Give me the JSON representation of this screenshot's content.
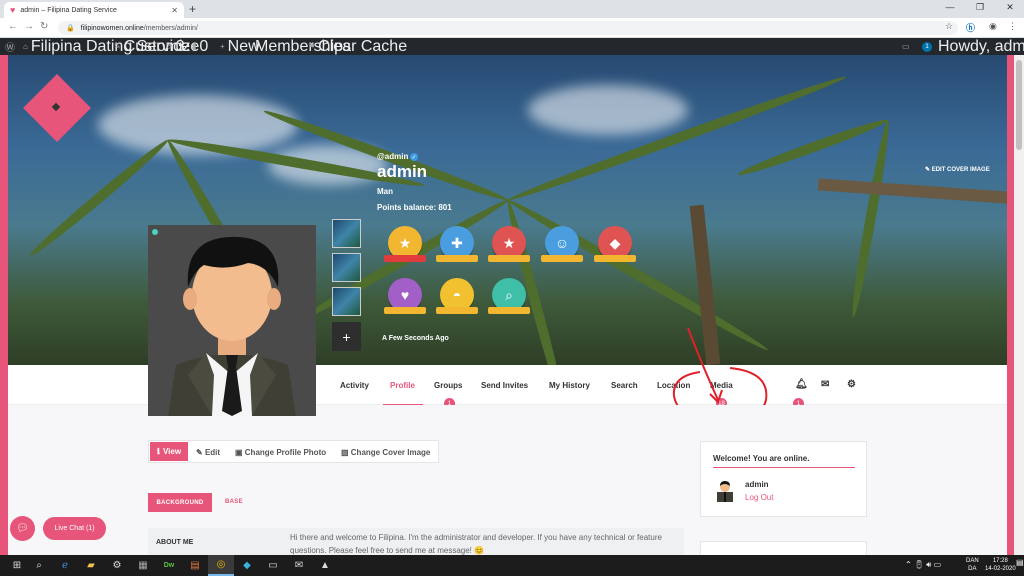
{
  "browser": {
    "tab_title": "admin – Filipina Dating Service",
    "url_host": "filipinowomen.online",
    "url_path": "/members/admin/",
    "new_tab": "+",
    "win_minimize": "—",
    "win_restore": "❐",
    "win_close": "✕"
  },
  "wpbar": {
    "site_name": "Filipina Dating Service",
    "customize": "Customize",
    "updates_count": "3",
    "comments_count": "0",
    "new_label": "New",
    "memberships": "Memberships",
    "clear_cache": "Clear Cache",
    "notif_count": "1",
    "howdy": "Howdy, admin"
  },
  "profile": {
    "edit_cover": "EDIT COVER IMAGE",
    "handle": "@admin",
    "name": "admin",
    "gender": "Man",
    "points": "Points balance: 801",
    "last_seen": "A Few Seconds Ago",
    "add_media": "+"
  },
  "badges": [
    {
      "name": "gold-star-badge",
      "glyph": "★",
      "color": "#f2b630",
      "ribbon": "#e23b3b"
    },
    {
      "name": "blue-plus-badge",
      "glyph": "✚",
      "color": "#4a9ee0",
      "ribbon": "#f2b630"
    },
    {
      "name": "red-star-badge",
      "glyph": "★",
      "color": "#e05353",
      "ribbon": "#f2b630"
    },
    {
      "name": "blue-user-badge",
      "glyph": "☺",
      "color": "#4a9ee0",
      "ribbon": "#f2b630"
    },
    {
      "name": "red-diamond-badge",
      "glyph": "◆",
      "color": "#e05353",
      "ribbon": "#f2b630"
    },
    {
      "name": "purple-heart-badge",
      "glyph": "♥",
      "color": "#a35fc8",
      "ribbon": "#f2b630"
    },
    {
      "name": "yellow-half-badge",
      "glyph": "◓",
      "color": "#f2c130",
      "ribbon": "#f2b630"
    },
    {
      "name": "teal-search-badge",
      "glyph": "⌕",
      "color": "#3fbfa8",
      "ribbon": "#f2b630"
    }
  ],
  "nav": {
    "activity": "Activity",
    "profile": "Profile",
    "groups": "Groups",
    "groups_count": "1",
    "send_invites": "Send Invites",
    "my_history": "My History",
    "search": "Search",
    "location": "Location",
    "media": "Media",
    "media_count": "18",
    "notif_count": "1"
  },
  "subnav": {
    "view": "View",
    "edit": "Edit",
    "change_photo": "Change Profile Photo",
    "change_cover": "Change Cover Image"
  },
  "fields": {
    "background_tab": "BACKGROUND",
    "base_tab": "BASE",
    "about_label": "ABOUT ME",
    "about_value": "Hi there and welcome to Filipina. I'm the administrator and developer. If you have any technical or feature questions. Please feel free to send me at message! 😊"
  },
  "welcome": {
    "title": "Welcome! You are online.",
    "name": "admin",
    "logout": "Log Out"
  },
  "livechat": {
    "label": "Live Chat (1)"
  },
  "tray": {
    "lang_top": "DAN",
    "lang_bottom": "DA",
    "time": "17:28",
    "date": "14-02-2020"
  },
  "colors": {
    "accent": "#e8557a",
    "annotation": "#e0202a"
  }
}
